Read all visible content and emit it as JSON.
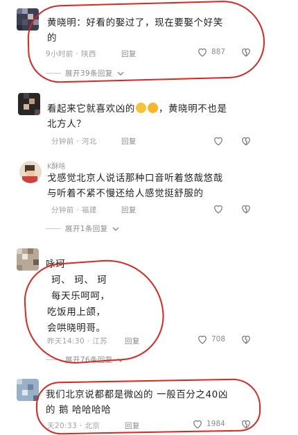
{
  "comments": [
    {
      "name": "",
      "text_lines": [
        "黄晓明：好看的娶过了，现在要娶个好笑",
        "的"
      ],
      "time": "9小时前",
      "location": "陕西",
      "reply_label": "回复",
      "likes": "887",
      "expand_label": "展开39条回复"
    },
    {
      "name": "",
      "text_lines": [
        "看起来它就喜欢凶的",
        "，黄晓明不也是",
        "北方人？"
      ],
      "time": "分钟前",
      "location": "河北",
      "reply_label": "回复",
      "likes": "",
      "expand_label": ""
    },
    {
      "name": "K酥啥",
      "text_lines": [
        "戈感觉北京人说话那种口音听着悠哉悠哉",
        "与听着不紧不慢还给人感觉挺舒服的"
      ],
      "time": "分钟前",
      "location": "福建",
      "reply_label": "回复",
      "likes": "",
      "expand_label": "展开1条回复"
    },
    {
      "name": "",
      "text_lines": [
        "咏珂",
        "珂、 珂、 珂",
        "每天乐呵呵，",
        "吃饭用上颌，",
        "会哄晓明哥。"
      ],
      "time": "昨天14:30",
      "location": "江苏",
      "reply_label": "回复",
      "likes": "708",
      "expand_label": "展开76条回复"
    },
    {
      "name": "",
      "text_lines": [
        "我们北京说都都是微凶的 一般百分之40凶",
        "的 鹅 哈哈哈哈"
      ],
      "time": "天20:33",
      "location": "北京",
      "reply_label": "回复",
      "likes": "1984",
      "expand_label": ""
    }
  ],
  "icons": {
    "like": "heart-outline-icon",
    "dislike": "broken-heart-icon",
    "expand": "chevron-down-icon",
    "emoji": "emoji-icon"
  },
  "colors": {
    "annotation_circle": "#e0231b",
    "meta_text": "#a0a0a0"
  }
}
